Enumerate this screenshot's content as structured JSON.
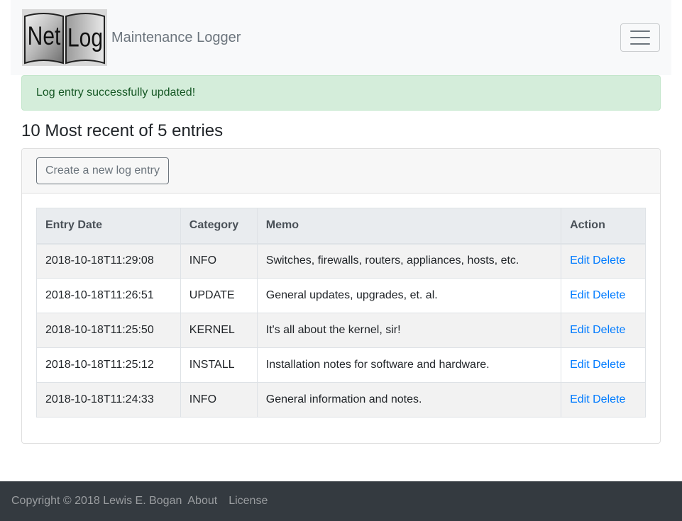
{
  "navbar": {
    "brand": "Maintenance Logger",
    "logo_text": {
      "left": "Net",
      "right": "Log"
    },
    "toggler_icon": "hamburger-menu-icon"
  },
  "alert": {
    "message": "Log entry successfully updated!"
  },
  "heading": "10 Most recent of 5 entries",
  "create_button": "Create a new log entry",
  "table": {
    "headers": [
      "Entry Date",
      "Category",
      "Memo",
      "Action"
    ],
    "rows": [
      {
        "date": "2018-10-18T11:29:08",
        "category": "INFO",
        "memo": "Switches, firewalls, routers, appliances, hosts, etc.",
        "edit": "Edit",
        "delete": "Delete"
      },
      {
        "date": "2018-10-18T11:26:51",
        "category": "UPDATE",
        "memo": "General updates, upgrades, et. al.",
        "edit": "Edit",
        "delete": "Delete"
      },
      {
        "date": "2018-10-18T11:25:50",
        "category": "KERNEL",
        "memo": "It's all about the kernel, sir!",
        "edit": "Edit",
        "delete": "Delete"
      },
      {
        "date": "2018-10-18T11:25:12",
        "category": "INSTALL",
        "memo": "Installation notes for software and hardware.",
        "edit": "Edit",
        "delete": "Delete"
      },
      {
        "date": "2018-10-18T11:24:33",
        "category": "INFO",
        "memo": "General information and notes.",
        "edit": "Edit",
        "delete": "Delete"
      }
    ]
  },
  "footer": {
    "copyright": "Copyright © 2018 Lewis E. Bogan",
    "about": "About",
    "license": "License"
  },
  "colors": {
    "navbar_bg": "#f8f9fa",
    "alert_bg": "#d4edda",
    "alert_text": "#155724",
    "link": "#007bff",
    "footer_bg": "#343a40"
  }
}
